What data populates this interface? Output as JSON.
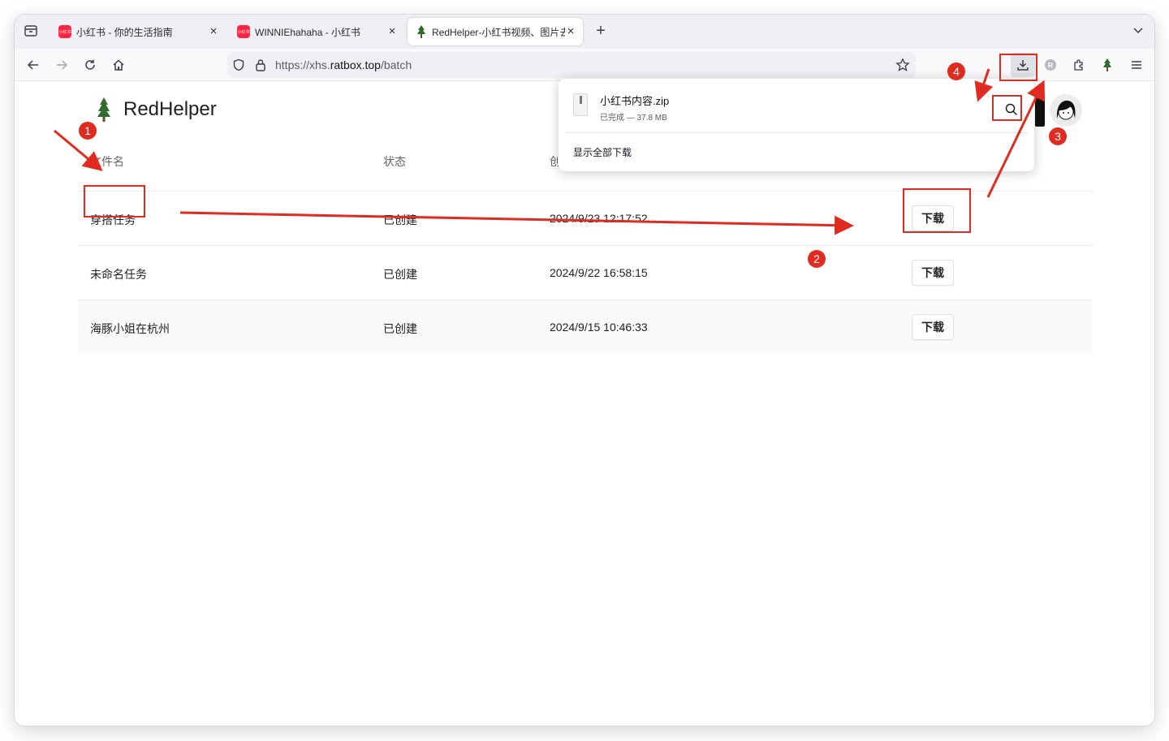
{
  "tabs": [
    {
      "favicon": "小红书",
      "title": "小红书 - 你的生活指南",
      "close": "×"
    },
    {
      "favicon": "小红书",
      "title": "WINNIEhahaha - 小红书",
      "close": "×"
    },
    {
      "title": "RedHelper-小红书视频、图片去水",
      "close": "×"
    }
  ],
  "new_tab_label": "+",
  "address": {
    "prefix": "https://xhs.",
    "domain": "ratbox.top",
    "path": "/batch"
  },
  "brand": {
    "name": "RedHelper"
  },
  "table": {
    "headers": {
      "name": "文件名",
      "status": "状态",
      "created": "创"
    },
    "rows": [
      {
        "name": "穿搭任务",
        "status": "已创建",
        "created": "2024/9/23 12:17:52",
        "action": "下载"
      },
      {
        "name": "未命名任务",
        "status": "已创建",
        "created": "2024/9/22 16:58:15",
        "action": "下载"
      },
      {
        "name": "海豚小姐在杭州",
        "status": "已创建",
        "created": "2024/9/15 10:46:33",
        "action": "下载"
      }
    ]
  },
  "downloads": {
    "file_name": "小红书内容.zip",
    "file_status": "已完成 — 37.8 MB",
    "show_all": "显示全部下载"
  },
  "annotations": {
    "markers": [
      "1",
      "2",
      "3",
      "4"
    ],
    "color": "#e02b20"
  },
  "colors": {
    "accent_red": "#e02b20",
    "xhs_red": "#ff2442",
    "tree_green": "#2e6b2e"
  }
}
